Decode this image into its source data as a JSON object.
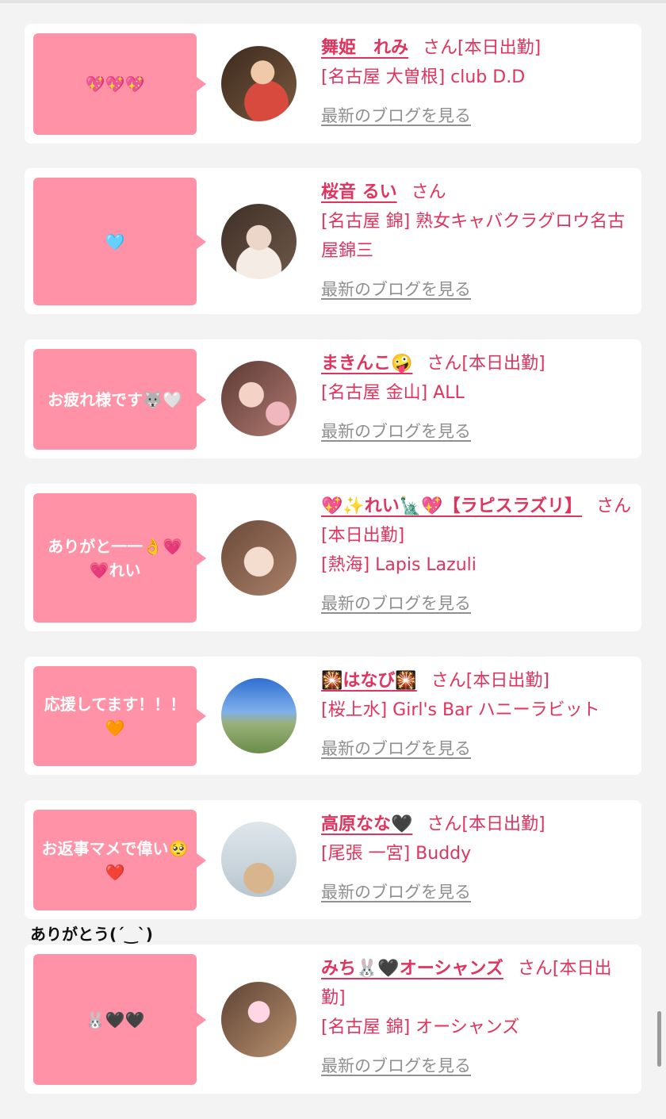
{
  "entries": [
    {
      "message": "💖💖💖",
      "name": "舞姫　れみ",
      "suffix": "さん[本日出勤]",
      "shop": "[名古屋 大曽根] club D.D",
      "blog_link": "最新のブログを見る",
      "avatar_colors": [
        "#3c2a1e",
        "#d84a3e"
      ]
    },
    {
      "message": "🩵",
      "name": "桜音 るい",
      "suffix": "さん",
      "shop": "[名古屋 錦] 熟女キャバクラグロウ名古屋錦三",
      "blog_link": "最新のブログを見る",
      "avatar_colors": [
        "#5a4638",
        "#e8d6cc"
      ]
    },
    {
      "message": "お疲れ様です🐺🤍",
      "name": "まきんこ🤪",
      "suffix": "さん[本日出勤]",
      "shop": "[名古屋 金山] ALL",
      "blog_link": "最新のブログを見る",
      "avatar_colors": [
        "#5c3a34",
        "#f1b7bf"
      ]
    },
    {
      "message": "ありがと一一👌💗💗れい",
      "name": "💖✨れい🗽💖【ラピスラズリ】",
      "suffix": "さん[本日出勤]",
      "shop": "[熱海] Lapis Lazuli",
      "blog_link": "最新のブログを見る",
      "avatar_colors": [
        "#6b4a3a",
        "#efd2c4"
      ]
    },
    {
      "message": "応援してます！！！🧡",
      "name": "🎇はなび🎇",
      "suffix": "さん[本日出勤]",
      "shop": "[桜上水] Girl's Bar ハニーラビット",
      "blog_link": "最新のブログを見る",
      "avatar_colors": [
        "#2f6fd2",
        "#7c9a5a"
      ]
    },
    {
      "message": "お返事マメで偉い🥺❤️",
      "name": "高原なな🖤",
      "suffix": "さん[本日出勤]",
      "shop": "[尾張 一宮] Buddy",
      "blog_link": "最新のブログを見る",
      "avatar_colors": [
        "#cfd8de",
        "#d9b58d"
      ]
    },
    {
      "message": "🐰🖤🖤",
      "name": "みち🐰🖤オーシャンズ",
      "suffix": "さん[本日出勤]",
      "shop": "[名古屋 錦] オーシャンズ",
      "blog_link": "最新のブログを見る",
      "avatar_colors": [
        "#5e4335",
        "#f2c9d6"
      ]
    }
  ],
  "caption": "ありがとう(´‿`)"
}
